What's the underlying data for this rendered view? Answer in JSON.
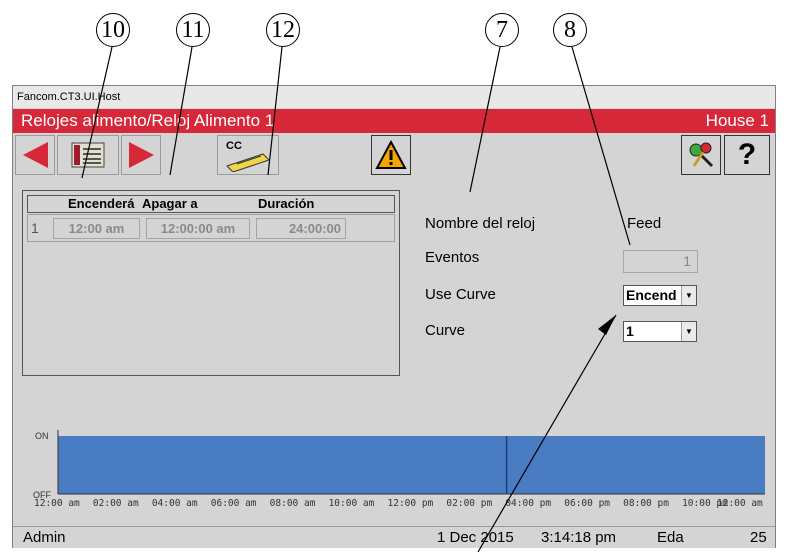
{
  "callouts": [
    "10",
    "11",
    "12",
    "7",
    "8"
  ],
  "window": {
    "title": "Fancom.CT3.UI.Host",
    "header": "Relojes alimento/Reloj Alimento 1",
    "house": "House 1"
  },
  "toolbar": {
    "icons": [
      "back-arrow-icon",
      "list-icon",
      "forward-arrow-icon",
      "cc-icon",
      "warning-icon",
      "keys-icon",
      "help-icon"
    ],
    "cc_label": "CC",
    "help_label": "?"
  },
  "table": {
    "headers": [
      "Encenderá",
      "Apagar a",
      "Duración"
    ],
    "rows": [
      {
        "index": "1",
        "on": "12:00 am",
        "off": "12:00:00 am",
        "duration": "24:00:00"
      }
    ]
  },
  "settings": {
    "clock_name_label": "Nombre del reloj",
    "clock_name_value": "Feed",
    "events_label": "Eventos",
    "events_value": "1",
    "use_curve_label": "Use Curve",
    "use_curve_value": "Encend",
    "curve_label": "Curve",
    "curve_value": "1"
  },
  "chart_data": {
    "type": "area",
    "y_labels": [
      "ON",
      "OFF"
    ],
    "x_ticks": [
      "12:00 am",
      "02:00 am",
      "04:00 am",
      "06:00 am",
      "08:00 am",
      "10:00 am",
      "12:00 pm",
      "02:00 pm",
      "04:00 pm",
      "06:00 pm",
      "08:00 pm",
      "10:00 pm",
      "12:00 am"
    ],
    "state_on_fraction": 1.0,
    "marker_hour": 15.23,
    "fill_color": "#4a7cc4"
  },
  "status": {
    "user": "Admin",
    "date": "1 Dec 2015",
    "time": "3:14:18 pm",
    "mode": "Eda",
    "number": "25"
  }
}
